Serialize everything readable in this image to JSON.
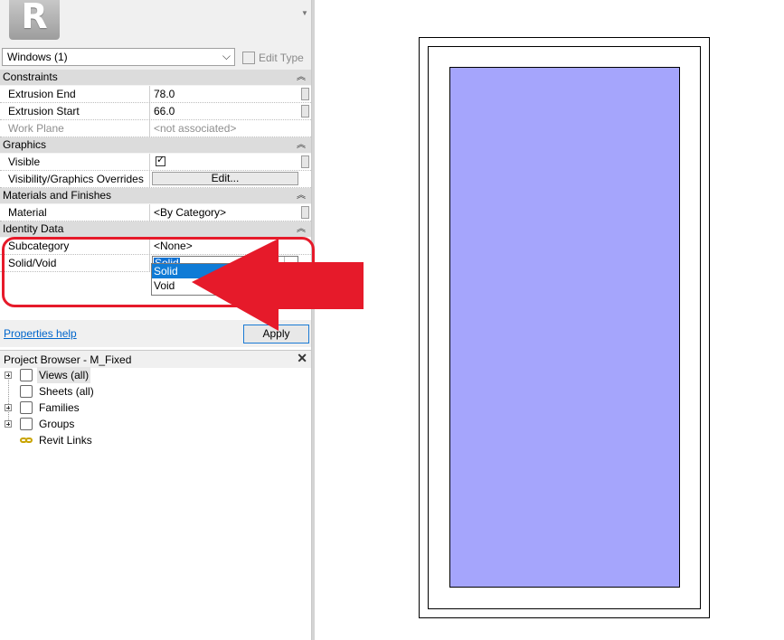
{
  "properties": {
    "type_selector": {
      "value": "Windows (1)"
    },
    "edit_type_label": "Edit Type",
    "sections": {
      "constraints": "Constraints",
      "graphics": "Graphics",
      "materials": "Materials and Finishes",
      "identity": "Identity Data"
    },
    "rows": {
      "extrusion_end": {
        "name": "Extrusion End",
        "value": "78.0"
      },
      "extrusion_start": {
        "name": "Extrusion Start",
        "value": "66.0"
      },
      "work_plane": {
        "name": "Work Plane",
        "value": "<not associated>"
      },
      "visible": {
        "name": "Visible",
        "checked": true
      },
      "visibility_overrides": {
        "name": "Visibility/Graphics Overrides",
        "button": "Edit..."
      },
      "material": {
        "name": "Material",
        "value": "<By Category>"
      },
      "subcategory": {
        "name": "Subcategory",
        "value": "<None>"
      },
      "solid_void": {
        "name": "Solid/Void",
        "value": "Solid"
      }
    },
    "dropdown_options": [
      "Solid",
      "Void"
    ],
    "help_link": "Properties help",
    "apply_label": "Apply"
  },
  "project_browser": {
    "title": "Project Browser - M_Fixed",
    "items": [
      {
        "label": "Views (all)",
        "icon": "views-icon"
      },
      {
        "label": "Sheets (all)",
        "icon": "sheets-icon"
      },
      {
        "label": "Families",
        "icon": "families-icon"
      },
      {
        "label": "Groups",
        "icon": "groups-icon"
      },
      {
        "label": "Revit Links",
        "icon": "revit-links-icon"
      }
    ]
  },
  "logo_letter": "R",
  "colors": {
    "glass_fill": "#a5a5fc",
    "annotation_red": "#e61a2a",
    "selection_blue": "#0f7bd6"
  }
}
